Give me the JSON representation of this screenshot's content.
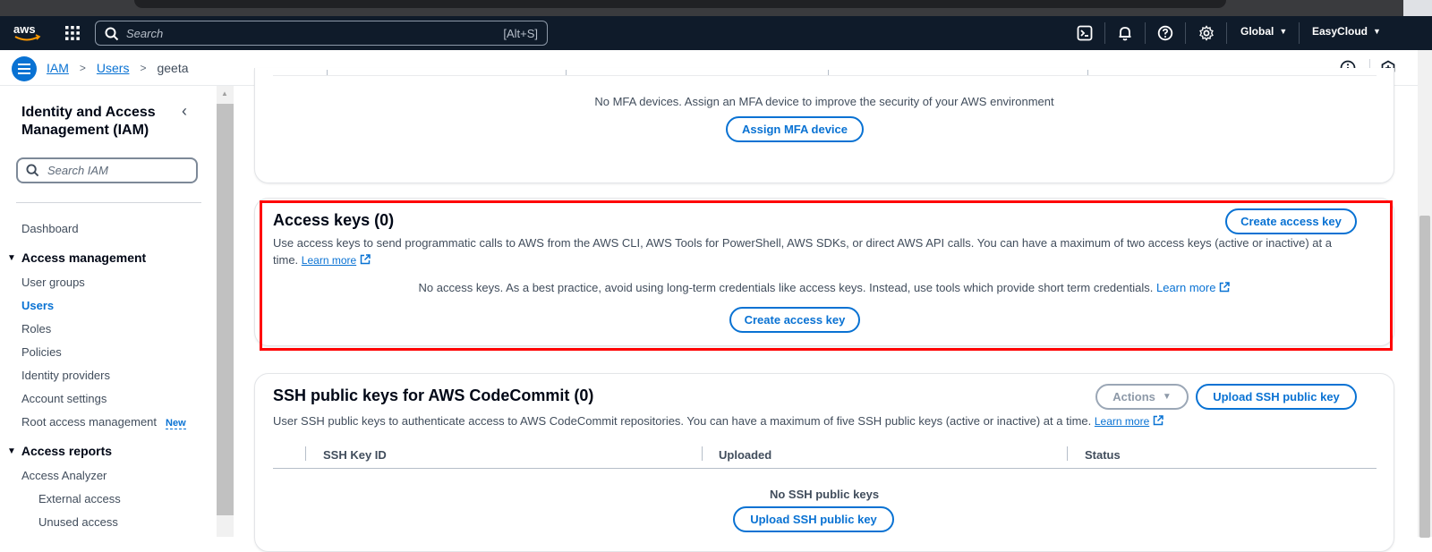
{
  "topnav": {
    "search_placeholder": "Search",
    "search_shortcut": "[Alt+S]",
    "region_label": "Global",
    "account_label": "EasyCloud",
    "icons": [
      "aws-logo",
      "grid-icon",
      "cloudshell-icon",
      "bell-icon",
      "help-icon",
      "gear-icon"
    ]
  },
  "breadcrumb": {
    "items": [
      "IAM",
      "Users"
    ],
    "current": "geeta"
  },
  "sidebar": {
    "title": "Identity and Access Management (IAM)",
    "search_placeholder": "Search IAM",
    "dashboard": "Dashboard",
    "access_management": {
      "heading": "Access management",
      "items": [
        "User groups",
        "Users",
        "Roles",
        "Policies",
        "Identity providers",
        "Account settings",
        "Root access management"
      ],
      "active": "Users",
      "new_badge": "New"
    },
    "access_reports": {
      "heading": "Access reports",
      "items": [
        "Access Analyzer"
      ],
      "subitems": [
        "External access",
        "Unused access"
      ]
    }
  },
  "mfa": {
    "empty_text": "No MFA devices. Assign an MFA device to improve the security of your AWS environment",
    "assign_button": "Assign MFA device"
  },
  "access_keys": {
    "title": "Access keys (0)",
    "create_button_header": "Create access key",
    "description": "Use access keys to send programmatic calls to AWS from the AWS CLI, AWS Tools for PowerShell, AWS SDKs, or direct AWS API calls. You can have a maximum of two access keys (active or inactive) at a time.",
    "learn_more": "Learn more",
    "empty_text": "No access keys. As a best practice, avoid using long-term credentials like access keys. Instead, use tools which provide short term credentials.",
    "empty_learn_more": "Learn more",
    "create_button": "Create access key"
  },
  "ssh_keys": {
    "title": "SSH public keys for AWS CodeCommit (0)",
    "actions_button": "Actions",
    "upload_button_header": "Upload SSH public key",
    "description": "User SSH public keys to authenticate access to AWS CodeCommit repositories. You can have a maximum of five SSH public keys (active or inactive) at a time.",
    "learn_more": "Learn more",
    "columns": [
      "SSH Key ID",
      "Uploaded",
      "Status"
    ],
    "empty_text": "No SSH public keys",
    "upload_button": "Upload SSH public key"
  },
  "colors": {
    "nav_bg": "#0f1b2a",
    "link_blue": "#0972d3",
    "highlight_red": "#ff0000",
    "text_dark": "#000716",
    "text_muted": "#414d5c"
  }
}
